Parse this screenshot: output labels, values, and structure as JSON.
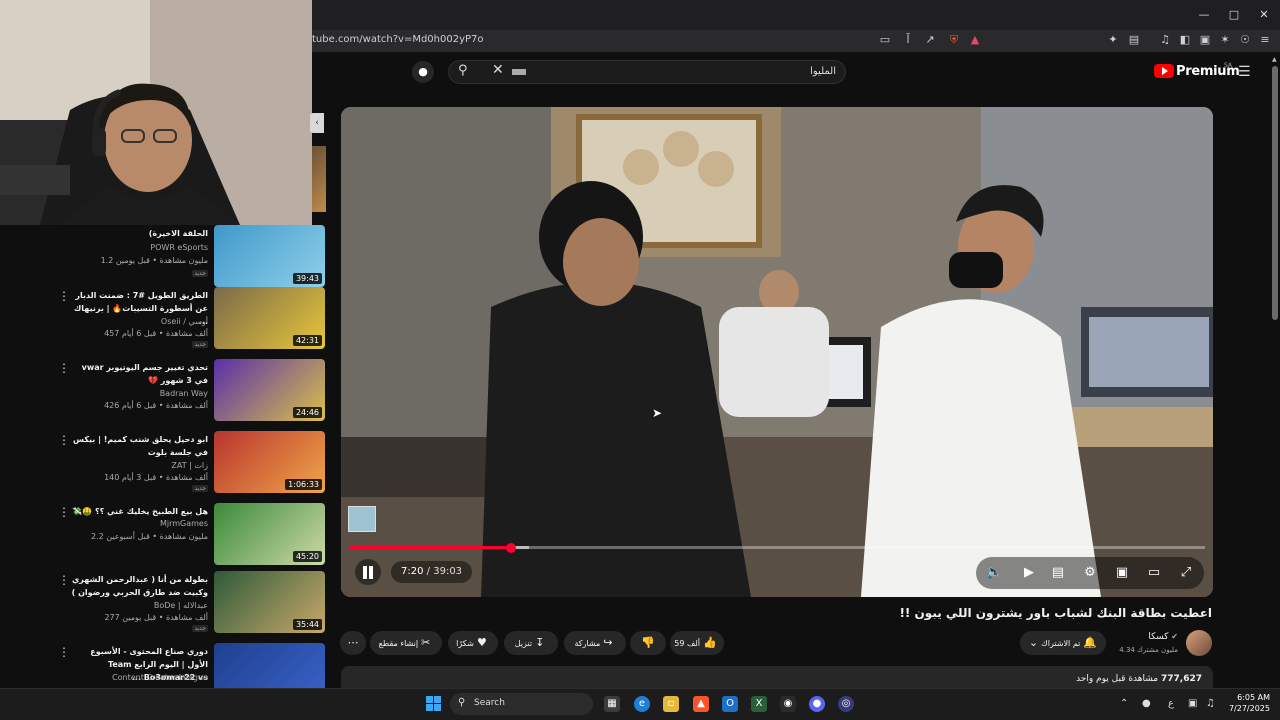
{
  "browser": {
    "url": "tube.com/watch?v=Md0h002yP7o",
    "window_controls": [
      "minimize-icon",
      "maximize-icon",
      "close-icon"
    ]
  },
  "header": {
    "search_text": "المليوا",
    "brand": "Premium",
    "country_code": "SA"
  },
  "recommendations": [
    {
      "title": "الحلقة الاخيرة)",
      "channel": "POWR eSports",
      "meta": "1.2 مليون مشاهدة • قبل يومين",
      "badge": "جديد",
      "duration": "39:43",
      "thumb_colors": [
        "#3f98c9",
        "#8fd0ea"
      ]
    },
    {
      "title": "الطريق الطويل #7 : ضمنت الدبار عن أسطورة التسيبات🔥 | برنيهاك ...",
      "channel": "Oseii / أوسي",
      "meta": "457 ألف مشاهدة • قبل 6 أيام",
      "badge": "جديد",
      "duration": "42:31",
      "thumb_colors": [
        "#7a6a4a",
        "#e8c63a"
      ]
    },
    {
      "title": "تحدي تغيير جسم اليوتيوبر vwar في 3 شهور 💔",
      "channel": "Badran Way",
      "meta": "426 ألف مشاهدة • قبل 6 أيام",
      "badge": "",
      "duration": "24:46",
      "thumb_colors": [
        "#5a2fa8",
        "#d9c14a"
      ]
    },
    {
      "title": "ابو دحيل يحلق شنب كميم! | بيكس في جلسة بلوت",
      "channel": "ZAT | زات",
      "meta": "140 ألف مشاهدة • قبل 3 أيام",
      "badge": "جديد",
      "duration": "1:06:33",
      "thumb_colors": [
        "#b8352e",
        "#f0a64a"
      ]
    },
    {
      "title": "هل بيع الطبيخ يخليك غني ؟؟ 🤑💸",
      "channel": "MjrmGames",
      "meta": "2.2 مليون مشاهدة • قبل أسبوعين",
      "badge": "",
      "duration": "45:20",
      "thumb_colors": [
        "#3a8a3a",
        "#cfd9a8"
      ]
    },
    {
      "title": "بطولة من أنا ( عبدالرحمن الشهري وكبيت ضد طارق الحربي ورضوان )",
      "channel": "BoDe | عبدالاله",
      "meta": "277 ألف مشاهدة • قبل يومين",
      "badge": "جديد",
      "duration": "35:44",
      "thumb_colors": [
        "#2e5a3a",
        "#c9a86a"
      ]
    },
    {
      "title": "دوري صناع المحتوى - الأسبوع الأول | اليوم الرابع Team Bo3omar22 vs ...",
      "channel": "Content Creator League",
      "meta": "",
      "badge": "",
      "duration": "",
      "thumb_colors": [
        "#1f3f8f",
        "#3a64c9"
      ]
    }
  ],
  "player": {
    "current_time": "7:20",
    "total_time": "39:03",
    "progress_fraction": 0.188,
    "buffered_fraction": 0.21
  },
  "video": {
    "title": "اعطيت بطاقة البنك لشباب باور يشترون اللي يبون !!",
    "channel": "كسكا",
    "subscribers": "4.34 مليون مشترك",
    "subscribe_label": "تم الاشتراك",
    "likes": "59 ألف",
    "share_label": "مشاركة",
    "download_label": "تنزيل",
    "thanks_label": "شكرًا",
    "clip_label": "إنشاء مقطع",
    "views": "777,627",
    "views_suffix": "مشاهدة قبل يوم واحد"
  },
  "taskbar": {
    "search_label": "Search",
    "tray_lang": "ع",
    "time": "6:05 AM",
    "date": "7/27/2025"
  },
  "colors": {
    "accent": "#ff0033",
    "background": "#0f0f0f",
    "brand_red": "#ff0000"
  }
}
